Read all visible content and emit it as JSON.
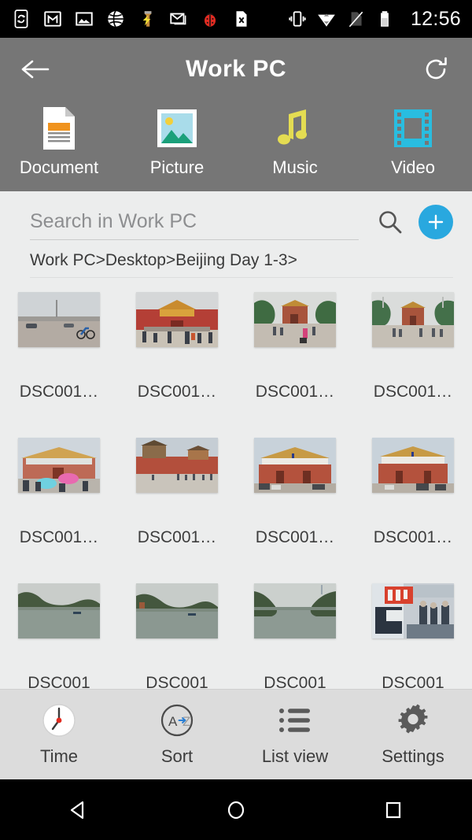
{
  "status_bar": {
    "time": "12:56",
    "left_icons": [
      "phone-sync-icon",
      "gmail-icon",
      "photos-icon",
      "browser-globe-icon",
      "flashlight-icon",
      "email-icon",
      "ladybug-icon",
      "spreadsheet-x-icon"
    ],
    "right_icons": [
      "vibrate-icon",
      "wifi-icon",
      "no-sim-icon",
      "battery-icon"
    ]
  },
  "app_bar": {
    "title": "Work PC",
    "back_icon": "back-arrow-icon",
    "refresh_icon": "refresh-icon"
  },
  "category_tabs": [
    {
      "label": "Document",
      "icon": "document-icon",
      "color": "#f0931e"
    },
    {
      "label": "Picture",
      "icon": "picture-icon",
      "color": "#1aa07a"
    },
    {
      "label": "Music",
      "icon": "music-note-icon",
      "color": "#e4dc52"
    },
    {
      "label": "Video",
      "icon": "film-strip-icon",
      "color": "#29bde0"
    }
  ],
  "search": {
    "placeholder": "Search in Work PC",
    "value": "",
    "search_icon": "search-icon",
    "add_button_label": "+",
    "add_button_color": "#29a8df"
  },
  "breadcrumb": {
    "path": "Work PC>Desktop>Beijing Day 1-3>"
  },
  "grid": {
    "items": [
      {
        "label": "DSC001…",
        "scene": "square-plaza"
      },
      {
        "label": "DSC001…",
        "scene": "gate-crowd"
      },
      {
        "label": "DSC001…",
        "scene": "avenue-trees"
      },
      {
        "label": "DSC001…",
        "scene": "avenue-wide"
      },
      {
        "label": "DSC001…",
        "scene": "palace-umbrella"
      },
      {
        "label": "DSC001…",
        "scene": "palace-wall"
      },
      {
        "label": "DSC001…",
        "scene": "palace-front"
      },
      {
        "label": "DSC001…",
        "scene": "palace-front2"
      },
      {
        "label": "DSC001",
        "scene": "river-1"
      },
      {
        "label": "DSC001",
        "scene": "river-2"
      },
      {
        "label": "DSC001",
        "scene": "river-3"
      },
      {
        "label": "DSC001",
        "scene": "subway-car"
      }
    ]
  },
  "bottom_bar": [
    {
      "label": "Time",
      "icon": "clock-icon"
    },
    {
      "label": "Sort",
      "icon": "sort-az-icon"
    },
    {
      "label": "List view",
      "icon": "list-view-icon"
    },
    {
      "label": "Settings",
      "icon": "gear-icon"
    }
  ],
  "nav_bar": [
    {
      "label": "Back",
      "icon": "nav-back-triangle-icon"
    },
    {
      "label": "Home",
      "icon": "nav-home-circle-icon"
    },
    {
      "label": "Recents",
      "icon": "nav-recents-square-icon"
    }
  ]
}
